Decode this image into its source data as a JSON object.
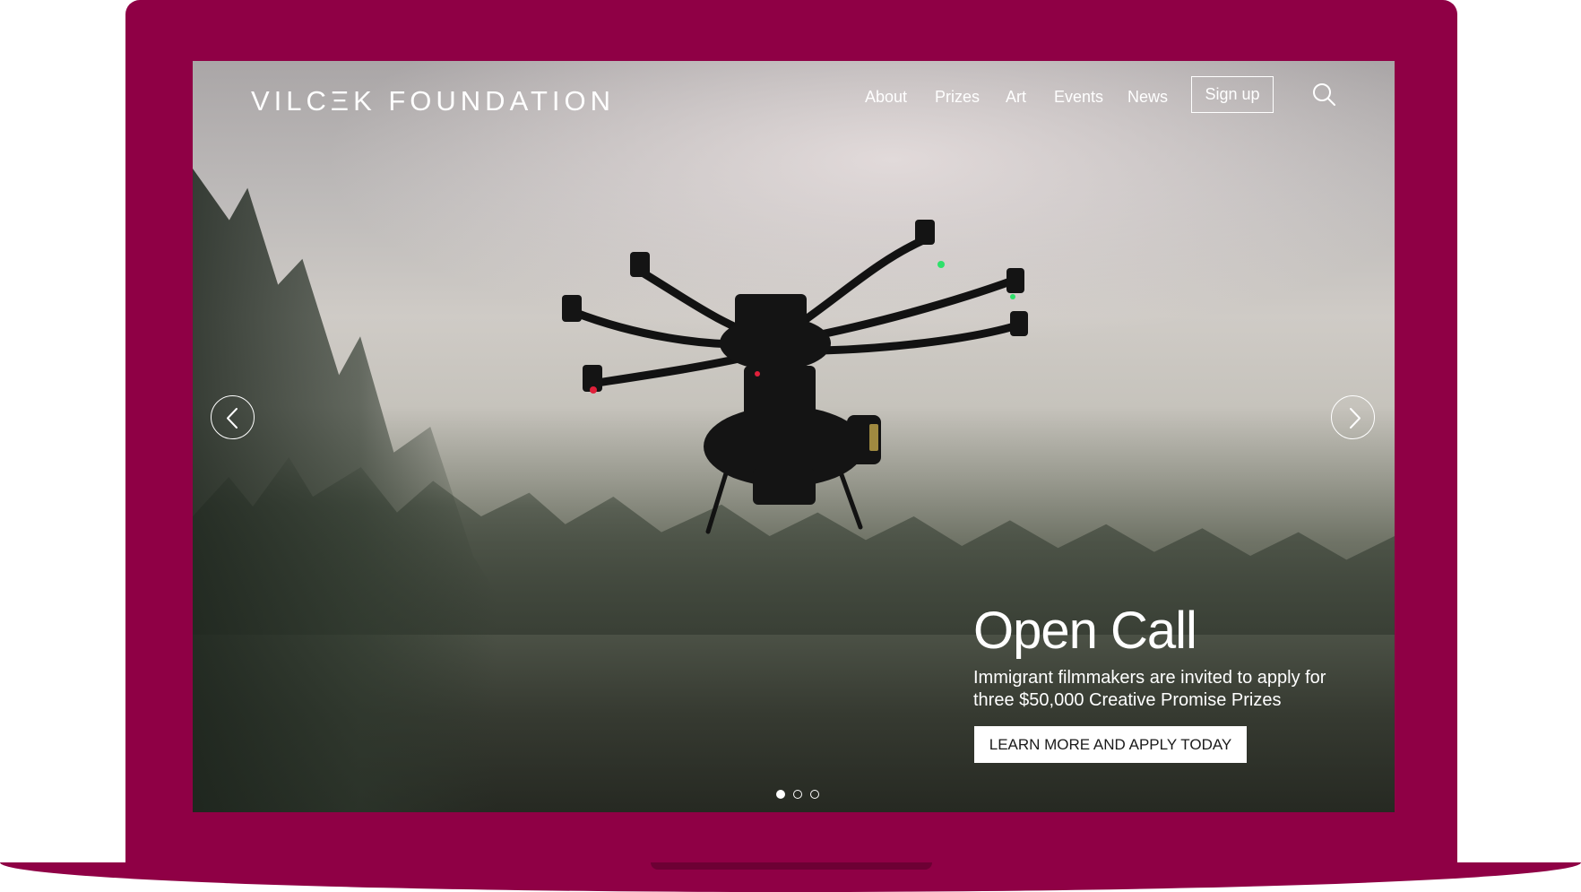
{
  "brand": {
    "frame_color": "#8f0045"
  },
  "header": {
    "logo": "VILCΞK FOUNDATION",
    "nav": [
      "About",
      "Prizes",
      "Art",
      "Events",
      "News"
    ],
    "signup_label": "Sign up",
    "search_icon": "search-icon"
  },
  "carousel": {
    "prev_icon": "chevron-left-icon",
    "next_icon": "chevron-right-icon",
    "slide_count": 3,
    "active_slide": 1
  },
  "hero": {
    "title": "Open Call",
    "text": "Immigrant filmmakers are invited to apply for three $50,000 Creative Promise Prizes",
    "cta_label": "LEARN MORE AND APPLY TODAY"
  }
}
